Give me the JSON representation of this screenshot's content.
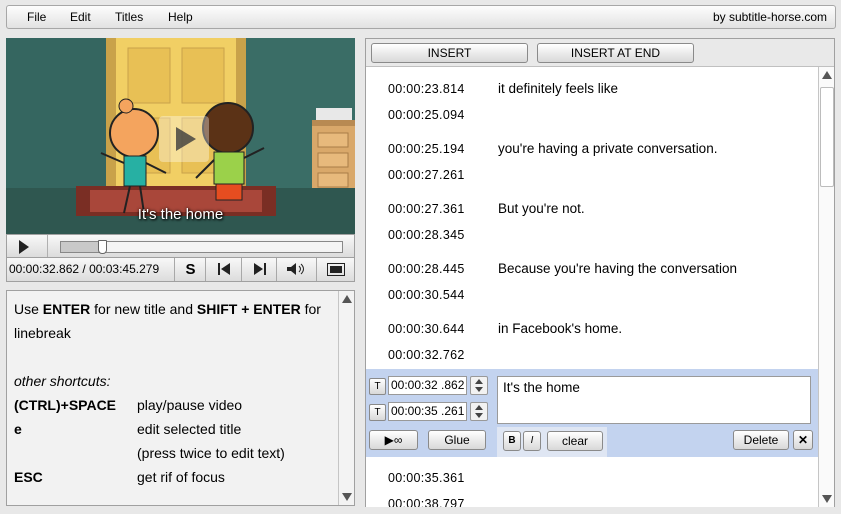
{
  "menu": {
    "items": [
      "File",
      "Edit",
      "Titles",
      "Help"
    ],
    "brand": "by subtitle-horse.com"
  },
  "video": {
    "subtitle_overlay": "It's the home"
  },
  "player": {
    "current_time": "00:00:32.862",
    "duration": "00:03:45.279",
    "time_readout": "00:00:32.862 / 00:03:45.279",
    "progress": 0.146,
    "s_label": "S"
  },
  "help": {
    "enter_key": "ENTER",
    "shift_enter_key": "SHIFT + ENTER",
    "line1_prefix": "Use ",
    "line1_mid": " for new title and ",
    "line1_suffix": " for",
    "line2": "linebreak",
    "other_shortcuts": "other shortcuts:",
    "shortcuts": [
      {
        "key": "(CTRL)+SPACE",
        "desc": "play/pause video"
      },
      {
        "key": "e",
        "desc": "edit selected title"
      },
      {
        "key": "",
        "desc": "(press twice to edit text)"
      },
      {
        "key": "ESC",
        "desc": "get rif of focus"
      }
    ]
  },
  "toolbar": {
    "insert_label": "INSERT",
    "insert_at_end_label": "INSERT AT END"
  },
  "subtitles": [
    {
      "start": "00:00:23.814",
      "end": "00:00:25.094",
      "text": "it definitely feels like"
    },
    {
      "start": "00:00:25.194",
      "end": "00:00:27.261",
      "text": "you're having a private conversation."
    },
    {
      "start": "00:00:27.361",
      "end": "00:00:28.345",
      "text": "But you're not."
    },
    {
      "start": "00:00:28.445",
      "end": "00:00:30.544",
      "text": "Because you're having the conversation"
    },
    {
      "start": "00:00:30.644",
      "end": "00:00:32.762",
      "text": "in Facebook's home."
    }
  ],
  "editing": {
    "start": "00:00:32 .862",
    "end": "00:00:35 .261",
    "text": "It's the home",
    "t_label": "T",
    "glue_label": "Glue",
    "bold_label": "B",
    "italic_label": "I",
    "clear_label": "clear",
    "delete_label": "Delete",
    "close_label": "✕",
    "play_loop_label": "▶∞"
  },
  "after_row": {
    "start": "00:00:35.361",
    "end": "00:00:38.797"
  },
  "colors": {
    "selected_row": "#c3d3ef",
    "format_panel": "#dfe6f3"
  }
}
